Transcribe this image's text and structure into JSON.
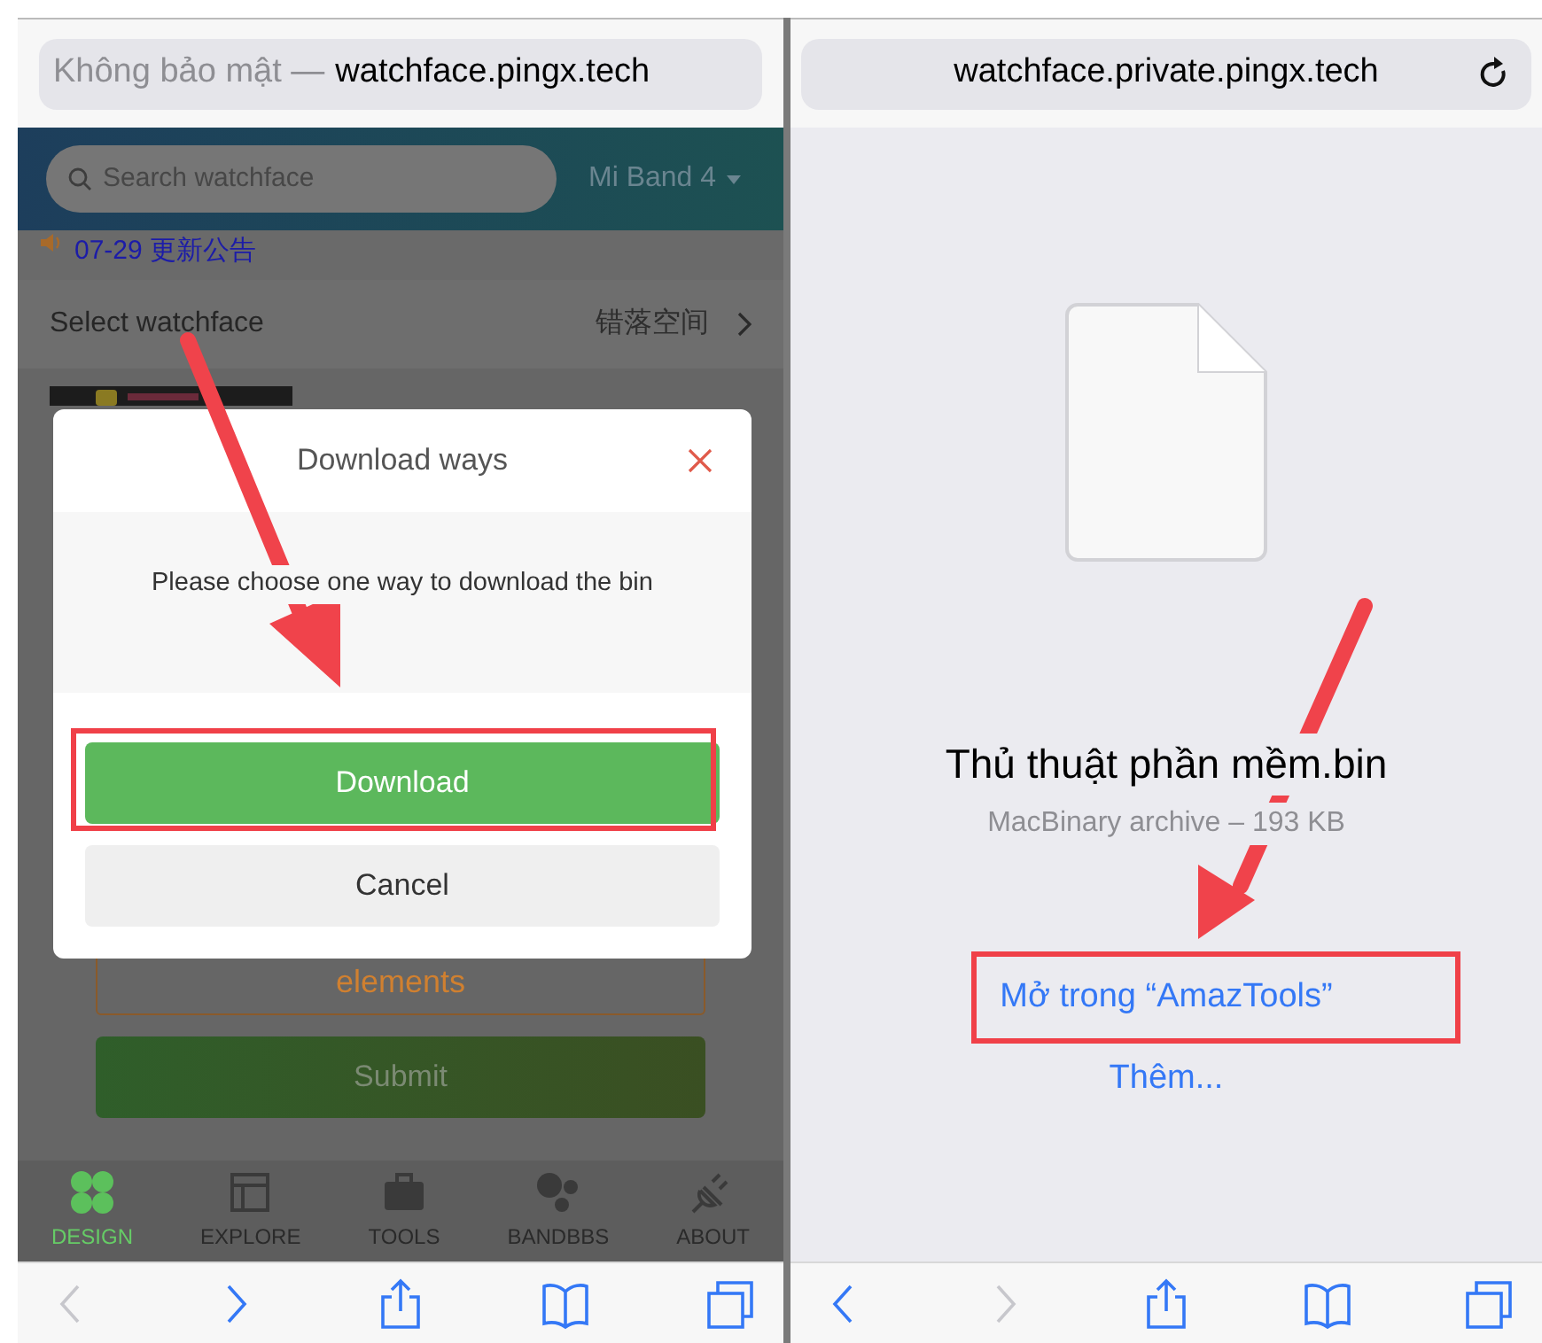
{
  "left_screen": {
    "address_bar": {
      "security_label": "Không bảo mật —",
      "url": "watchface.pingx.tech"
    },
    "search": {
      "placeholder": "Search watchface"
    },
    "device_menu": {
      "label": "Mi Band 4"
    },
    "notice": {
      "text": "07-29 更新公告"
    },
    "select_row": {
      "label": "Select watchface",
      "value": "错落空间"
    },
    "dialog": {
      "title": "Download ways",
      "message": "Please choose one way to download the bin",
      "buttons": [
        {
          "label": "Download",
          "kind": "primary",
          "highlighted": true
        },
        {
          "label": "Cancel",
          "kind": "secondary",
          "highlighted": false
        }
      ]
    },
    "elements_button": {
      "label": "elements"
    },
    "submit_button": {
      "label": "Submit"
    },
    "tabs": [
      {
        "label": "DESIGN",
        "selected": true
      },
      {
        "label": "EXPLORE",
        "selected": false
      },
      {
        "label": "TOOLS",
        "selected": false
      },
      {
        "label": "BANDBBS",
        "selected": false
      },
      {
        "label": "ABOUT",
        "selected": false
      }
    ],
    "toolbar": [
      {
        "kind": "back",
        "disabled": true
      },
      {
        "kind": "forward",
        "disabled": false
      },
      {
        "kind": "share",
        "disabled": false
      },
      {
        "kind": "bookmarks",
        "disabled": false
      },
      {
        "kind": "tabs",
        "disabled": false
      }
    ]
  },
  "right_screen": {
    "address_bar": {
      "url": "watchface.private.pingx.tech"
    },
    "file": {
      "name": "Thủ thuật phần mềm.bin",
      "info": "MacBinary archive – 193 KB"
    },
    "links": [
      {
        "label": "Mở trong “AmazTools”",
        "highlighted": true
      },
      {
        "label": "Thêm...",
        "highlighted": false
      }
    ],
    "toolbar": [
      {
        "kind": "back",
        "disabled": false
      },
      {
        "kind": "forward",
        "disabled": true
      },
      {
        "kind": "share",
        "disabled": false
      },
      {
        "kind": "bookmarks",
        "disabled": false
      },
      {
        "kind": "tabs",
        "disabled": false
      }
    ]
  }
}
